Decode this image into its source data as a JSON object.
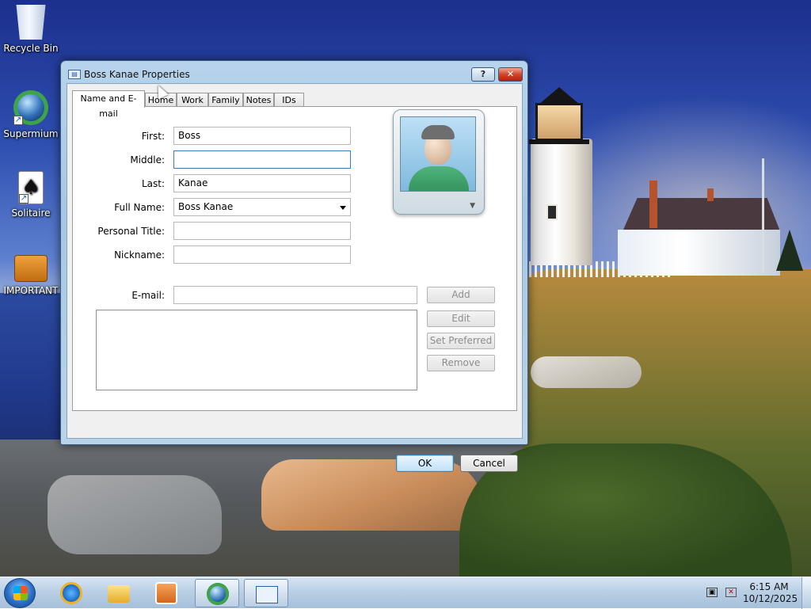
{
  "desktop": {
    "icons": [
      {
        "label": "Recycle Bin",
        "icon": "recycle-bin-icon"
      },
      {
        "label": "Supermium",
        "icon": "supermium-browser-icon"
      },
      {
        "label": "Solitaire",
        "icon": "solitaire-card-icon"
      },
      {
        "label": "IMPORTANT",
        "icon": "briefcase-icon"
      }
    ],
    "solitaire_glyph": "♠"
  },
  "dialog": {
    "title": "Boss Kanae Properties",
    "help_glyph": "?",
    "close_glyph": "✕",
    "tabs": [
      "Name and E-mail",
      "Home",
      "Work",
      "Family",
      "Notes",
      "IDs"
    ],
    "active_tab": "Name and E-mail",
    "fields": {
      "first": {
        "label": "First:",
        "value": "Boss"
      },
      "middle": {
        "label": "Middle:",
        "value": ""
      },
      "last": {
        "label": "Last:",
        "value": "Kanae"
      },
      "full_name": {
        "label": "Full Name:",
        "value": "Boss Kanae"
      },
      "personal_title": {
        "label": "Personal Title:",
        "value": ""
      },
      "nickname": {
        "label": "Nickname:",
        "value": ""
      },
      "email": {
        "label": "E-mail:",
        "value": ""
      }
    },
    "email_buttons": {
      "add": "Add",
      "edit": "Edit",
      "set_preferred": "Set Preferred",
      "remove": "Remove"
    },
    "photo_arrow": "▼",
    "ok_label": "OK",
    "cancel_label": "Cancel"
  },
  "taskbar": {
    "pinned": [
      "start-orb-icon",
      "internet-explorer-icon",
      "file-explorer-folder-icon",
      "media-player-icon",
      "supermium-browser-icon",
      "contact-card-icon"
    ],
    "clock_time": "6:15 AM",
    "clock_date": "10/12/2025",
    "tray_network_glyph": "▣",
    "tray_volume_glyph": "✕"
  },
  "colors": {
    "title_bar": "#b7d3ec",
    "close_button": "#d2462d",
    "default_button_border": "#3c7fb1",
    "taskbar": "#b9cfe5"
  }
}
